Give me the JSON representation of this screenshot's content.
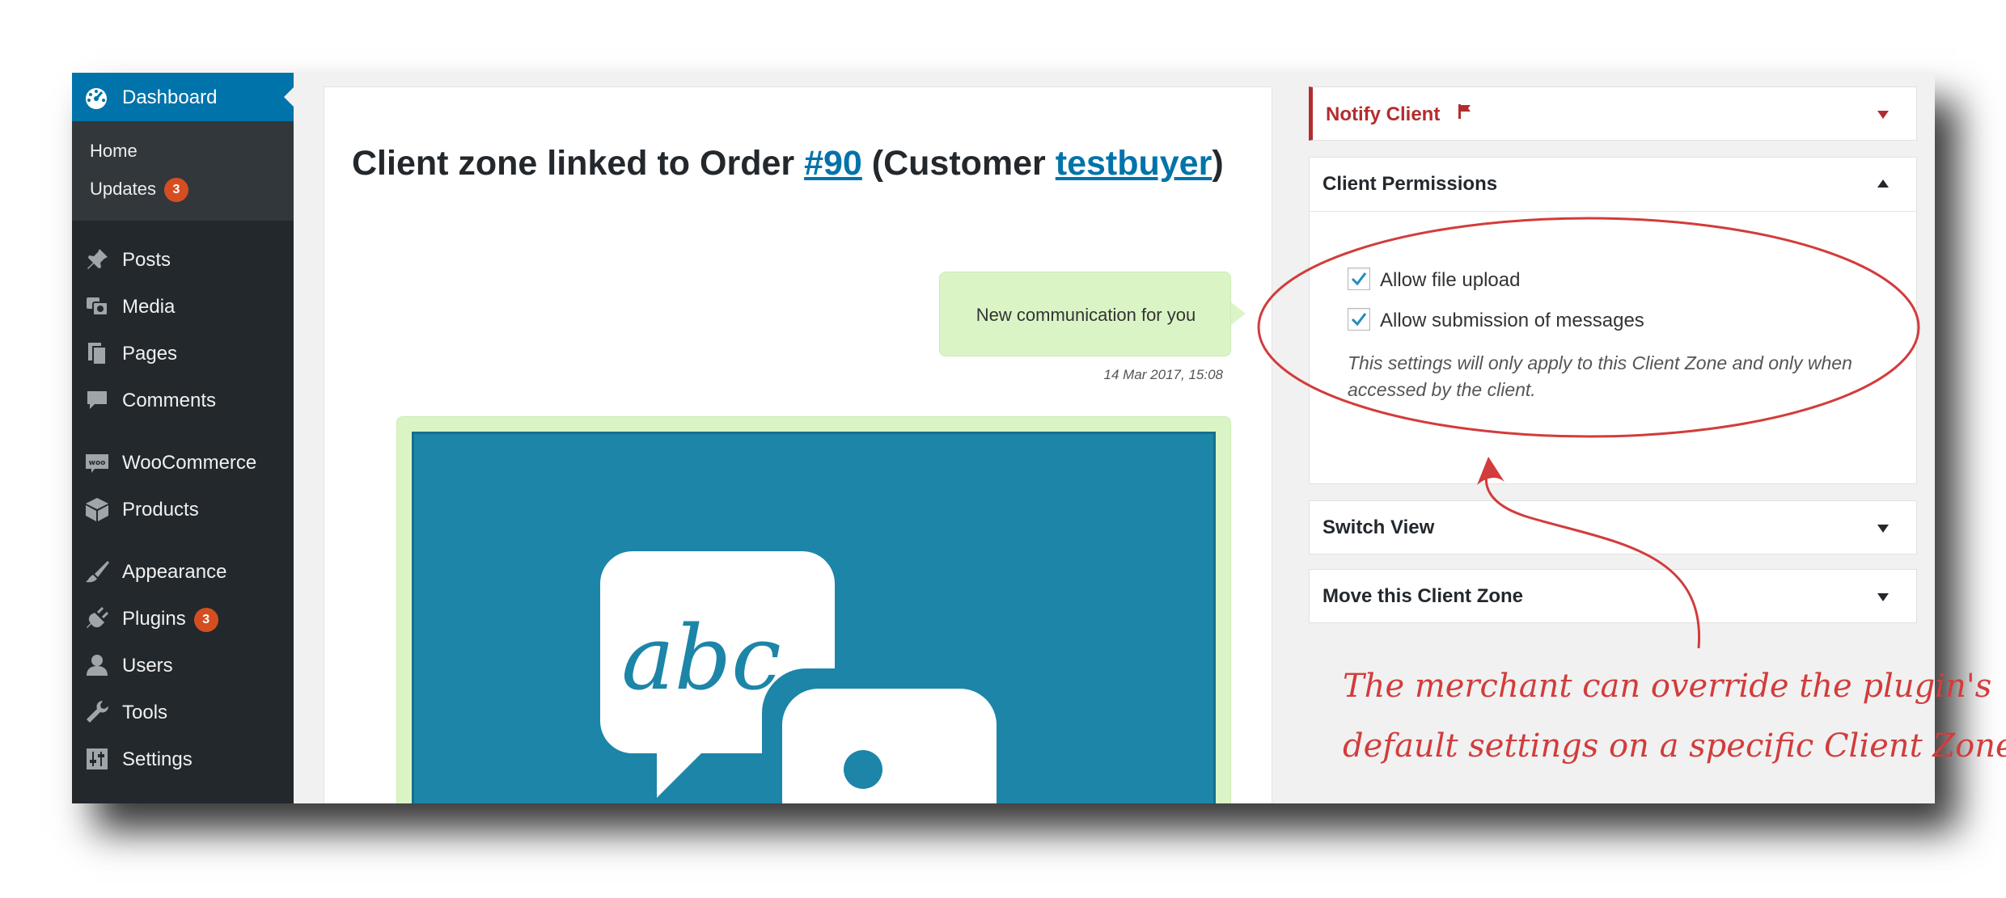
{
  "sidebar": {
    "dashboard_label": "Dashboard",
    "home_label": "Home",
    "updates_label": "Updates",
    "updates_badge": "3",
    "items": [
      {
        "label": "Posts"
      },
      {
        "label": "Media"
      },
      {
        "label": "Pages"
      },
      {
        "label": "Comments"
      },
      {
        "label": "WooCommerce"
      },
      {
        "label": "Products"
      },
      {
        "label": "Appearance"
      },
      {
        "label": "Plugins",
        "badge": "3"
      },
      {
        "label": "Users"
      },
      {
        "label": "Tools"
      },
      {
        "label": "Settings"
      }
    ],
    "woo_icon_text": "woo"
  },
  "main": {
    "title_prefix": "Client zone linked to Order ",
    "order_link": "#90",
    "title_middle": " (Customer ",
    "customer_link": "testbuyer",
    "title_suffix": ")",
    "message_text": "New communication for you",
    "message_time": "14 Mar 2017, 15:08",
    "attachment_text": "abc"
  },
  "panels": {
    "notify_title": "Notify Client",
    "permissions_title": "Client Permissions",
    "allow_upload": "Allow file upload",
    "allow_messages": "Allow submission of messages",
    "permissions_note": "This settings will only apply to this Client Zone and only when accessed by the client.",
    "switch_view_title": "Switch View",
    "move_title": "Move this Client Zone"
  },
  "annotation": {
    "line1": "The merchant can override the plugin's",
    "line2": "default settings on a specific Client Zone"
  },
  "colors": {
    "sidebar_bg": "#23282d",
    "accent": "#0073aa",
    "badge": "#d54e21",
    "bubble": "#dbf4c6",
    "notify": "#b32d2e",
    "annotation": "#d23c3c",
    "attachment_bg": "#1c85a8"
  }
}
